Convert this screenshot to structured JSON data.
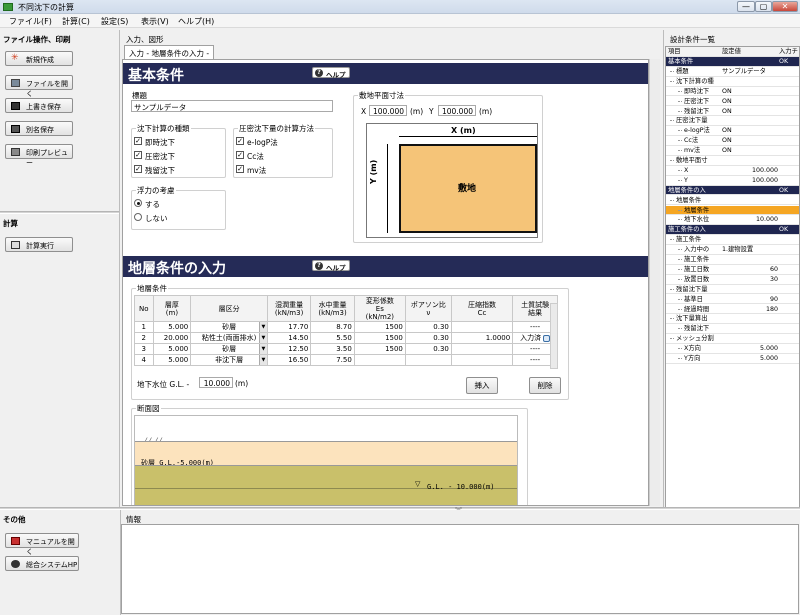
{
  "window": {
    "title": "不同沈下の計算",
    "buttons": [
      "—",
      "▢",
      "✕"
    ]
  },
  "menu": [
    "ファイル(F)",
    "計算(C)",
    "設定(S)",
    "表示(V)",
    "ヘルプ(H)"
  ],
  "left": {
    "file_title": "ファイル操作、印刷",
    "file_buttons": [
      "新規作成",
      "ファイルを開く",
      "上書き保存",
      "別名保存",
      "印刷プレビュー"
    ],
    "calc_title": "計算",
    "calc_button": "計算実行",
    "other_title": "その他",
    "other_buttons": [
      "マニュアルを開く",
      "総合システムHP"
    ]
  },
  "main": {
    "title": "入力、図形",
    "tab": "入力 - 地層条件の入力 -",
    "basic": {
      "header": "基本条件",
      "help": "ヘルプ",
      "label_title": "標題",
      "title_value": "サンプルデータ",
      "settle_group": "沈下計算の種類",
      "settle_items": [
        "即時沈下",
        "圧密沈下",
        "残留沈下"
      ],
      "method_group": "圧密沈下量の計算方法",
      "method_items": [
        "e-logP法",
        "Cc法",
        "mv法"
      ],
      "buoy_group": "浮力の考慮",
      "buoy_items": [
        "する",
        "しない"
      ],
      "plan_title": "敷地平面寸法",
      "x_label": "X",
      "x_value": "100.000",
      "y_label": "Y",
      "y_value": "100.000",
      "unit_m": "(m)",
      "plan_xlabel": "X (m)",
      "plan_ylabel": "Y (m)",
      "plan_center": "敷地"
    },
    "layer": {
      "header": "地層条件の入力",
      "help": "ヘルプ",
      "group": "地層条件",
      "columns": [
        "No",
        "層厚\n(m)",
        "層区分",
        "湿潤重量\n(kN/m3)",
        "水中重量\n(kN/m3)",
        "変形係数\nEs\n(kN/m2)",
        "ポアソン比\nν",
        "圧縮指数\nCc",
        "土質試験\n結果"
      ],
      "rows": [
        [
          "1",
          "5.000",
          "砂層",
          "17.70",
          "8.70",
          "1500",
          "0.30",
          "",
          "----"
        ],
        [
          "2",
          "20.000",
          "粘性土(両面排水)",
          "14.50",
          "5.50",
          "1500",
          "0.30",
          "1.0000",
          "入力済"
        ],
        [
          "3",
          "5.000",
          "砂層",
          "12.50",
          "3.50",
          "1500",
          "0.30",
          "",
          "----"
        ],
        [
          "4",
          "5.000",
          "非沈下層",
          "16.50",
          "7.50",
          "",
          "",
          "",
          "----"
        ]
      ],
      "gw_label": "地下水位  G.L. -",
      "gw_value": "10.000",
      "gw_unit": "(m)",
      "insert": "挿入",
      "delete": "削除",
      "section_title": "断面図",
      "section_label": "砂層  G.L.-5.000(m)",
      "section_gw": "G.L. - 10.000(m)"
    }
  },
  "right": {
    "title": "設計条件一覧",
    "headers": [
      "項目",
      "設定値",
      "入力チ"
    ],
    "rows": [
      {
        "t": "基本条件",
        "v": "",
        "c": "OK",
        "d": 0,
        "k": "hd"
      },
      {
        "t": "標題",
        "v": "サンプルデータ",
        "c": "",
        "d": 1,
        "k": ""
      },
      {
        "t": "沈下計算の種",
        "v": "",
        "c": "",
        "d": 1,
        "k": ""
      },
      {
        "t": "即時沈下",
        "v": "ON",
        "c": "",
        "d": 2,
        "k": ""
      },
      {
        "t": "圧密沈下",
        "v": "ON",
        "c": "",
        "d": 2,
        "k": ""
      },
      {
        "t": "残留沈下",
        "v": "ON",
        "c": "",
        "d": 2,
        "k": ""
      },
      {
        "t": "圧密沈下量",
        "v": "",
        "c": "",
        "d": 1,
        "k": ""
      },
      {
        "t": "e-logP法",
        "v": "ON",
        "c": "",
        "d": 2,
        "k": ""
      },
      {
        "t": "Cc法",
        "v": "ON",
        "c": "",
        "d": 2,
        "k": ""
      },
      {
        "t": "mv法",
        "v": "ON",
        "c": "",
        "d": 2,
        "k": ""
      },
      {
        "t": "敷地平面寸",
        "v": "",
        "c": "",
        "d": 1,
        "k": ""
      },
      {
        "t": "X",
        "v": "100.000",
        "c": "",
        "d": 2,
        "k": "num"
      },
      {
        "t": "Y",
        "v": "100.000",
        "c": "",
        "d": 2,
        "k": "num"
      },
      {
        "t": "地層条件の入",
        "v": "",
        "c": "OK",
        "d": 0,
        "k": "hd"
      },
      {
        "t": "地層条件",
        "v": "",
        "c": "",
        "d": 1,
        "k": ""
      },
      {
        "t": "地層条件",
        "v": "",
        "c": "",
        "d": 2,
        "k": "sel"
      },
      {
        "t": "地下水位",
        "v": "10.000",
        "c": "",
        "d": 2,
        "k": "num"
      },
      {
        "t": "施工条件の入",
        "v": "",
        "c": "OK",
        "d": 0,
        "k": "hd"
      },
      {
        "t": "施工条件",
        "v": "",
        "c": "",
        "d": 1,
        "k": ""
      },
      {
        "t": "入力中の",
        "v": "1.建物設置",
        "c": "",
        "d": 2,
        "k": ""
      },
      {
        "t": "施工条件",
        "v": "",
        "c": "",
        "d": 2,
        "k": ""
      },
      {
        "t": "施工日数",
        "v": "60",
        "c": "",
        "d": 2,
        "k": "num"
      },
      {
        "t": "放置日数",
        "v": "30",
        "c": "",
        "d": 2,
        "k": "num"
      },
      {
        "t": "残留沈下量",
        "v": "",
        "c": "",
        "d": 1,
        "k": ""
      },
      {
        "t": "基準日",
        "v": "90",
        "c": "",
        "d": 2,
        "k": "num"
      },
      {
        "t": "経過時間",
        "v": "180",
        "c": "",
        "d": 2,
        "k": "num"
      },
      {
        "t": "沈下量算出",
        "v": "",
        "c": "",
        "d": 1,
        "k": ""
      },
      {
        "t": "残留沈下",
        "v": "",
        "c": "",
        "d": 2,
        "k": ""
      },
      {
        "t": "メッシュ分割",
        "v": "",
        "c": "",
        "d": 1,
        "k": ""
      },
      {
        "t": "X方向",
        "v": "5.000",
        "c": "",
        "d": 2,
        "k": "num"
      },
      {
        "t": "Y方向",
        "v": "5.000",
        "c": "",
        "d": 2,
        "k": "num"
      }
    ]
  },
  "info": {
    "title": "情報"
  }
}
